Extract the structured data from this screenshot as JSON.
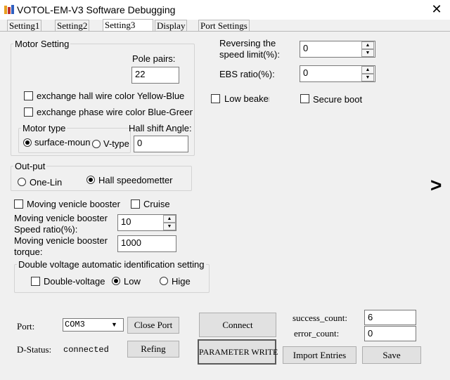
{
  "window": {
    "title": "VOTOL-EM-V3 Software Debugging",
    "close_glyph": "✕"
  },
  "tabs": [
    {
      "label": "Setting1"
    },
    {
      "label": "Setting2"
    },
    {
      "label": "Setting3"
    },
    {
      "label": "Display"
    },
    {
      "label": "Port Settings"
    }
  ],
  "motor_setting": {
    "legend": "Motor Setting",
    "pole_pairs_label": "Pole pairs:",
    "pole_pairs_value": "22",
    "exchange_hall_label": "exchange hall wire color Yellow-Blue",
    "exchange_phase_label": "exchange phase wire color Blue-Green",
    "motor_type_legend": "Motor type",
    "surface_label": "surface-mount",
    "vtype_label": "V-type",
    "hall_shift_label": "Hall shift Angle:",
    "hall_shift_value": "0"
  },
  "right_top": {
    "reversing_label_1": "Reversing the",
    "reversing_label_2": "speed limit(%):",
    "reversing_value": "0",
    "ebs_label": "EBS ratio(%):",
    "ebs_value": "0",
    "low_beaker_label": "Low beaker",
    "secure_boot_label": "Secure boot"
  },
  "output": {
    "legend": "Out-put",
    "one_lin_label": "One-Lin",
    "hall_speed_label": "Hall speedometter"
  },
  "booster": {
    "moving_booster_label": "Moving venicle booster",
    "cruise_label": "Cruise",
    "speed_ratio_label_1": "Moving venicle booster",
    "speed_ratio_label_2": "Speed ratio(%):",
    "speed_ratio_value": "10",
    "torque_label_1": "Moving venicle booster",
    "torque_label_2": "torque:",
    "torque_value": "1000"
  },
  "double_voltage": {
    "legend": "Double voltage automatic identification setting",
    "double_label": "Double-voltage",
    "low_label": "Low",
    "hige_label": "Hige"
  },
  "bottom": {
    "port_label": "Port:",
    "port_value": "COM3",
    "close_port_label": "Close Port",
    "connect_label": "Connect",
    "success_label": "success_count:",
    "success_value": "6",
    "error_label": "error_count:",
    "error_value": "0",
    "dstatus_label": "D-Status:",
    "dstatus_value": "connected",
    "refing_label": "Refing",
    "param_write_label": "PARAMETER WRITE",
    "import_label": "Import Entries",
    "save_label": "Save"
  },
  "icons": {
    "next_arrow": ">",
    "spin_up": "▲",
    "spin_down": "▼",
    "dropdown": "▼"
  }
}
